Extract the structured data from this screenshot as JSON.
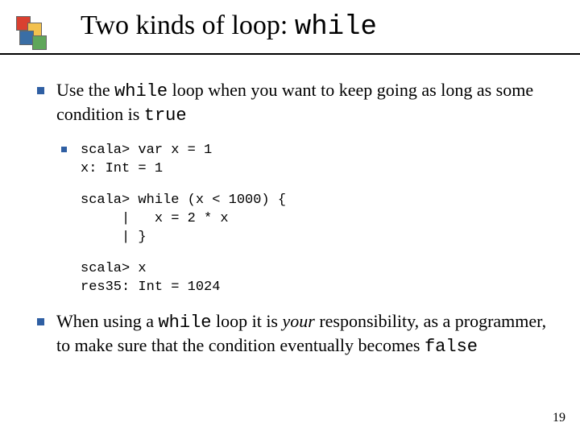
{
  "header": {
    "title_pre": "Two kinds of loop: ",
    "title_code": "while"
  },
  "bullets": {
    "b1": {
      "t1": "Use the ",
      "c1": "while",
      "t2": " loop when you want to keep going as long as some condition is ",
      "c2": "true"
    },
    "code": {
      "block1": "scala> var x = 1\nx: Int = 1",
      "block2": "scala> while (x < 1000) {\n     |   x = 2 * x\n     | }",
      "block3": "scala> x\nres35: Int = 1024"
    },
    "b2": {
      "t1": "When using a ",
      "c1": "while",
      "t2": " loop it is ",
      "em": "your",
      "t3": " responsibility, as a programmer, to make sure that the condition eventually becomes ",
      "c2": "false"
    }
  },
  "page_number": "19"
}
